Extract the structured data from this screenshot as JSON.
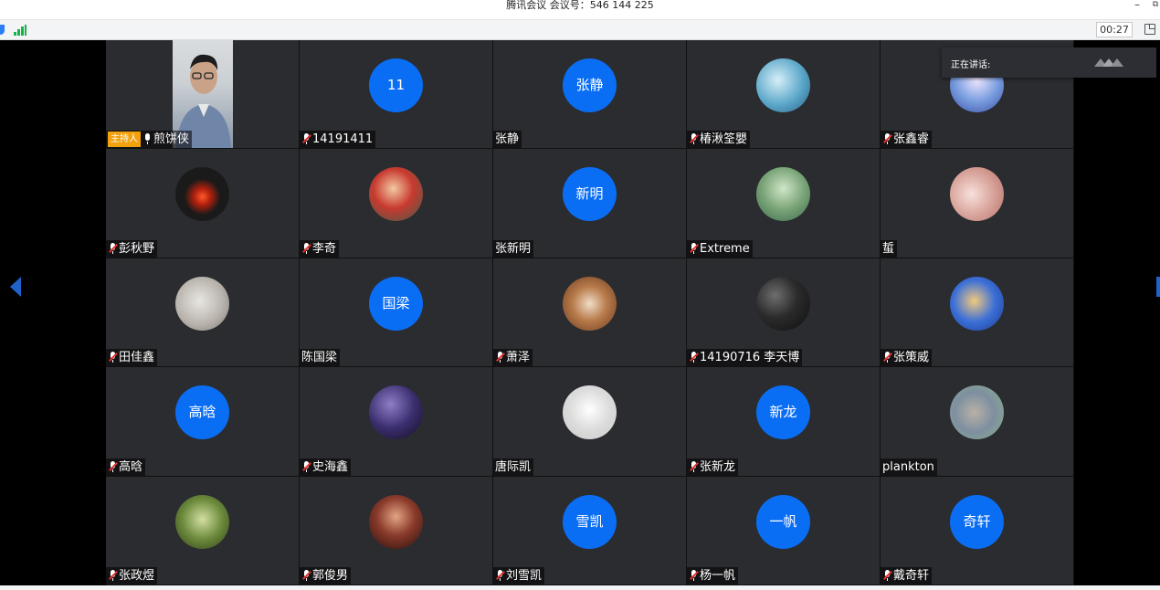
{
  "window": {
    "title": "腾讯会议 会议号：546 144 225",
    "minimize_glyph": "–",
    "restore_glyph": "⧉"
  },
  "toolbar": {
    "timer": "00:27",
    "shield_icon": "shield-icon",
    "signal_icon": "signal-icon",
    "layout_icon": "layout-icon"
  },
  "speaking": {
    "label": "正在讲话:"
  },
  "colors": {
    "avatar_blue": "#0a6ef5",
    "host_badge": "#f3a10d",
    "tile_bg": "#2a2c30",
    "muted_red": "#e0312d"
  },
  "participants": [
    {
      "name": "煎饼侠",
      "type": "video",
      "host": true,
      "host_label": "主持人",
      "mic": "on"
    },
    {
      "name": "14191411",
      "type": "text",
      "avatar": "11",
      "mic": "muted"
    },
    {
      "name": "张静",
      "type": "text",
      "avatar": "张静",
      "mic": "none"
    },
    {
      "name": "椿湫筌嬰",
      "type": "image",
      "mic": "muted"
    },
    {
      "name": "张鑫睿",
      "type": "image",
      "mic": "muted"
    },
    {
      "name": "彭秋野",
      "type": "image",
      "mic": "muted"
    },
    {
      "name": "李奇",
      "type": "image",
      "mic": "muted"
    },
    {
      "name": "张新明",
      "type": "text",
      "avatar": "新明",
      "mic": "none"
    },
    {
      "name": "Extreme",
      "type": "image",
      "mic": "muted"
    },
    {
      "name": "蜇",
      "type": "image",
      "mic": "none"
    },
    {
      "name": "田佳鑫",
      "type": "image",
      "mic": "muted"
    },
    {
      "name": "陈国梁",
      "type": "text",
      "avatar": "国梁",
      "mic": "none"
    },
    {
      "name": "萧泽",
      "type": "image",
      "mic": "muted"
    },
    {
      "name": "14190716 李天博",
      "type": "image",
      "mic": "muted"
    },
    {
      "name": "张策威",
      "type": "image",
      "mic": "muted"
    },
    {
      "name": "高晗",
      "type": "text",
      "avatar": "高晗",
      "mic": "muted"
    },
    {
      "name": "史海鑫",
      "type": "image",
      "mic": "muted"
    },
    {
      "name": "唐际凯",
      "type": "image",
      "mic": "none"
    },
    {
      "name": "张新龙",
      "type": "text",
      "avatar": "新龙",
      "mic": "muted"
    },
    {
      "name": "plankton",
      "type": "image",
      "mic": "none"
    },
    {
      "name": "张政煜",
      "type": "image",
      "mic": "muted"
    },
    {
      "name": "郭俊男",
      "type": "image",
      "mic": "muted"
    },
    {
      "name": "刘雪凯",
      "type": "text",
      "avatar": "雪凯",
      "mic": "muted"
    },
    {
      "name": "杨一帆",
      "type": "text",
      "avatar": "一帆",
      "mic": "muted"
    },
    {
      "name": "戴奇轩",
      "type": "text",
      "avatar": "奇轩",
      "mic": "muted"
    }
  ]
}
